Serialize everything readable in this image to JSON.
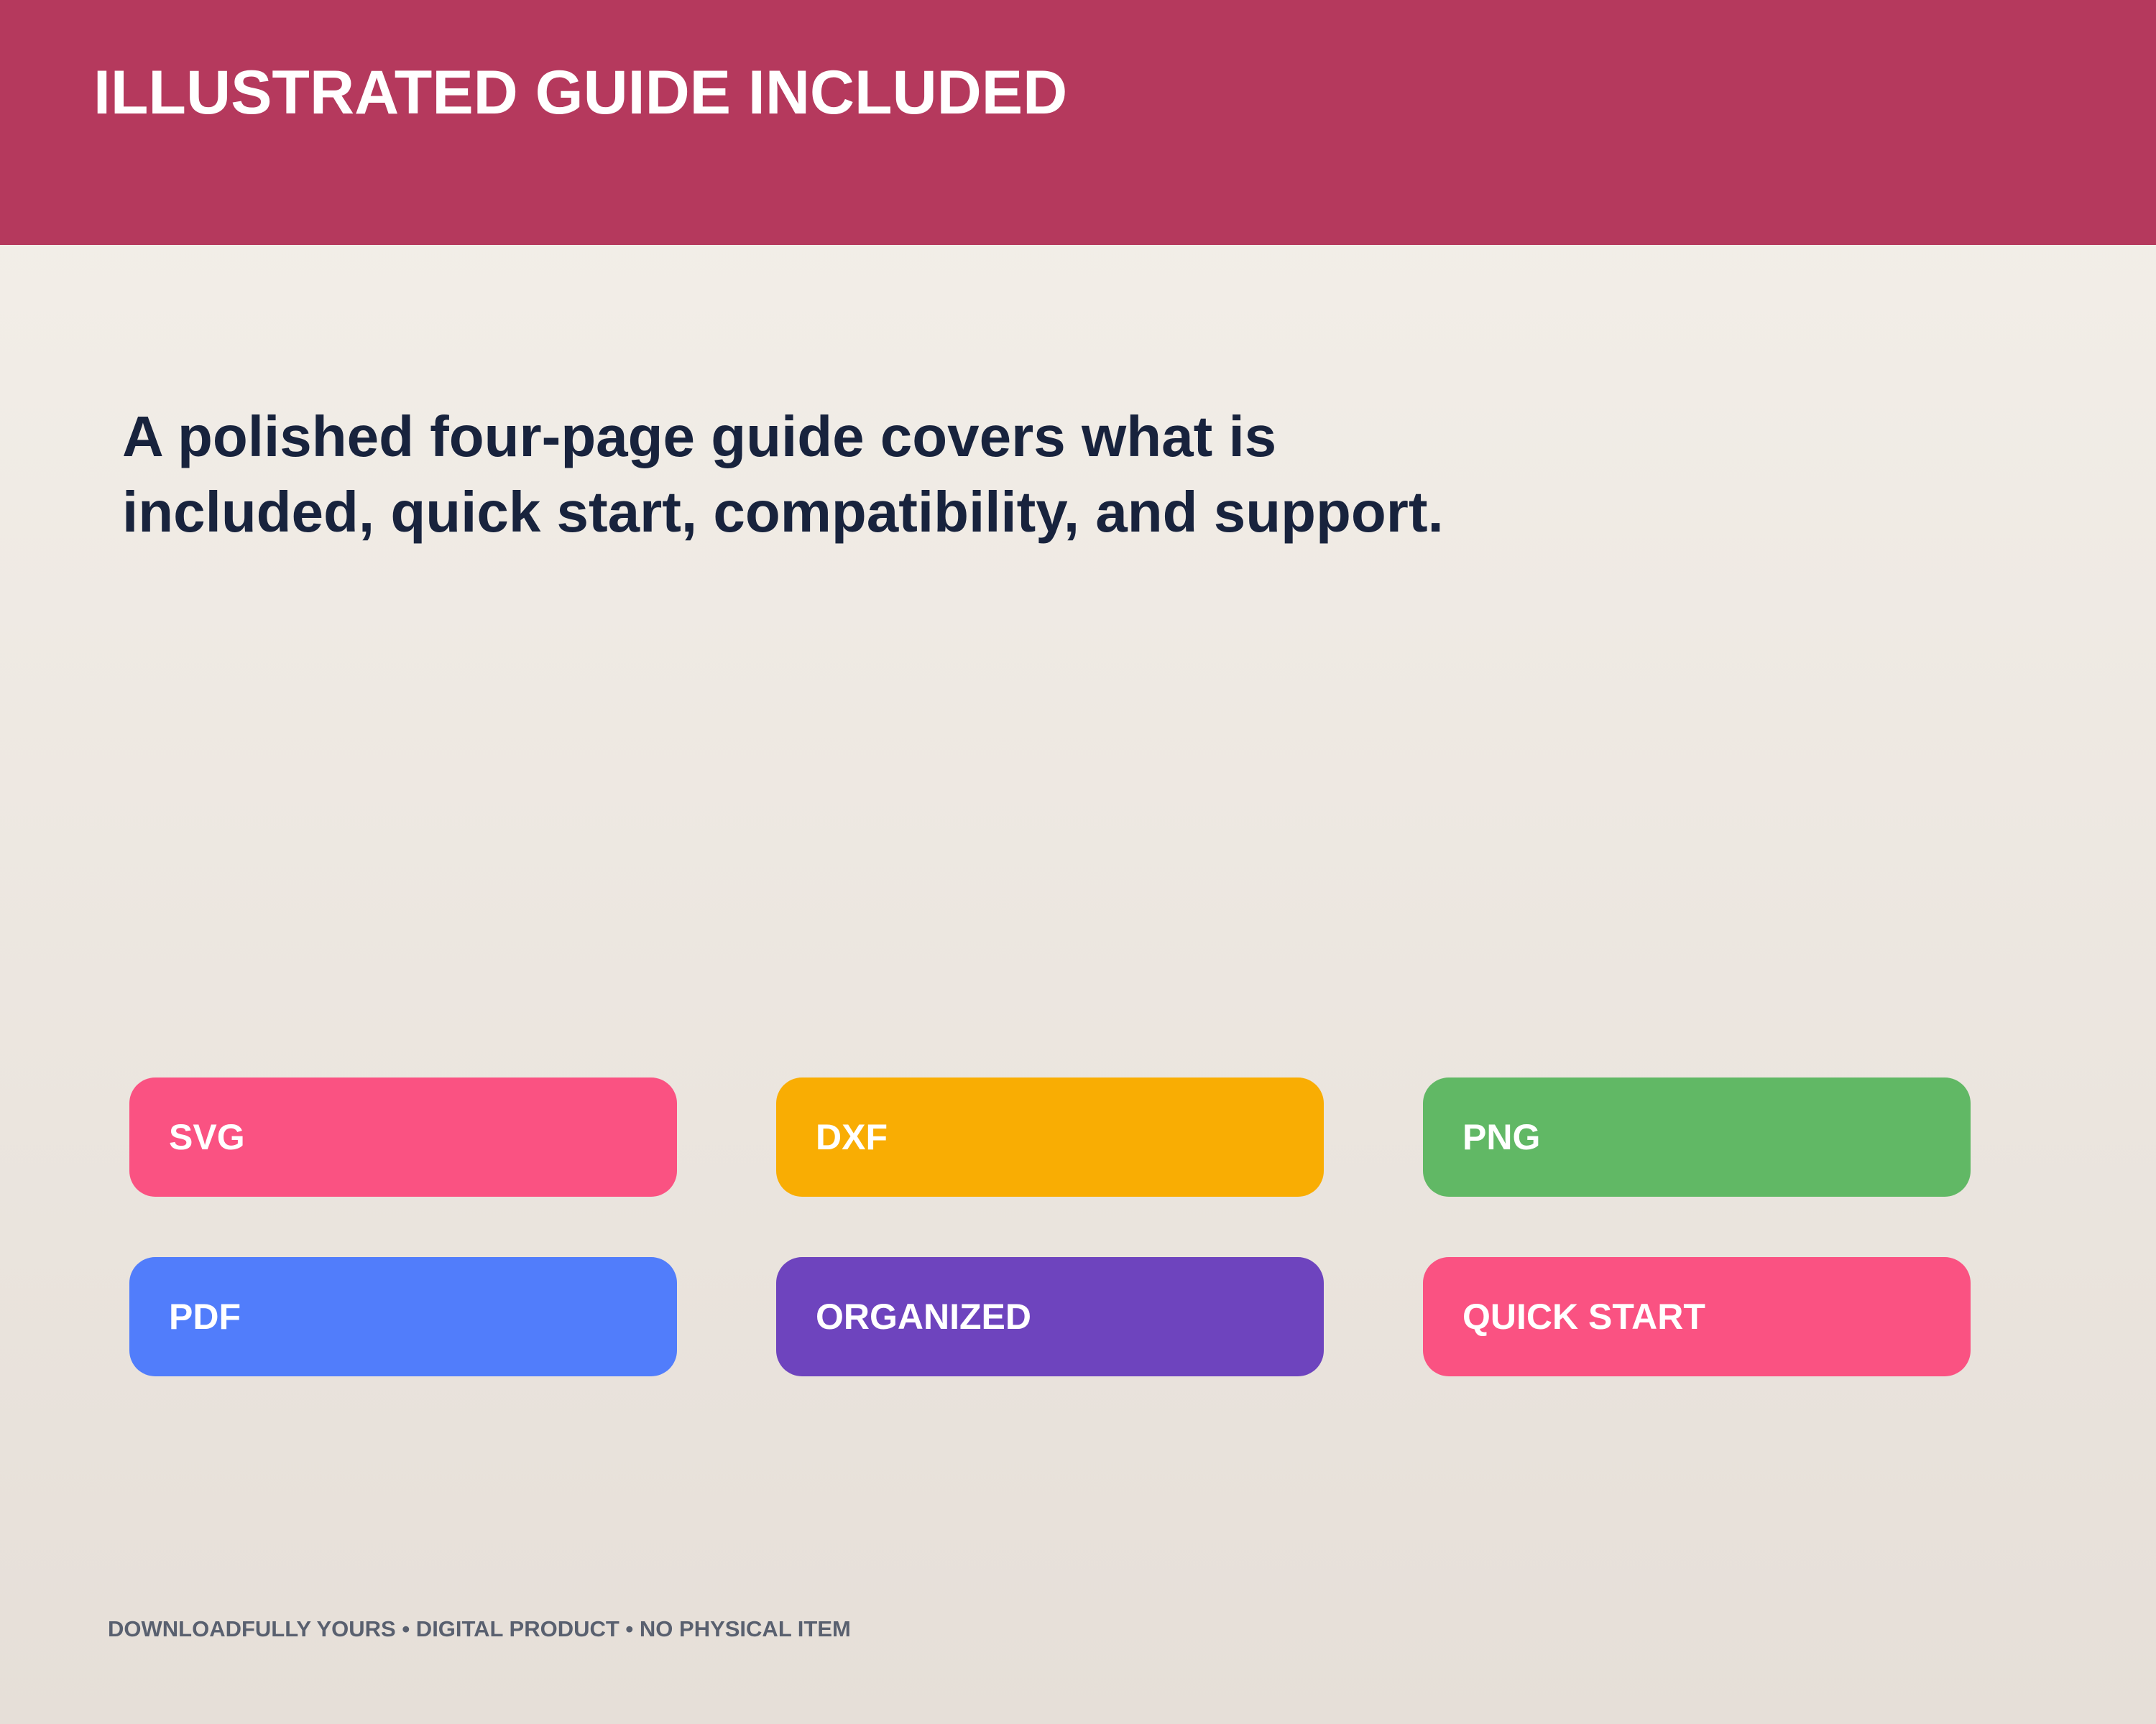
{
  "header": {
    "title": "ILLUSTRATED GUIDE INCLUDED"
  },
  "main": {
    "headline": "A polished four-page guide covers what is included, quick start, compatibility, and support."
  },
  "tags": [
    {
      "label": "SVG",
      "color": "#fa5282"
    },
    {
      "label": "DXF",
      "color": "#f9ad03"
    },
    {
      "label": "PNG",
      "color": "#61b865"
    },
    {
      "label": "PDF",
      "color": "#517dfb"
    },
    {
      "label": "ORGANIZED",
      "color": "#6e44be"
    },
    {
      "label": "QUICK START",
      "color": "#fa5282"
    }
  ],
  "footer": {
    "text": "DOWNLOADFULLY YOURS • DIGITAL PRODUCT • NO PHYSICAL ITEM"
  },
  "colors": {
    "header_background": "#b5395d",
    "headline_text": "#18233d",
    "footer_text": "#59606f"
  }
}
